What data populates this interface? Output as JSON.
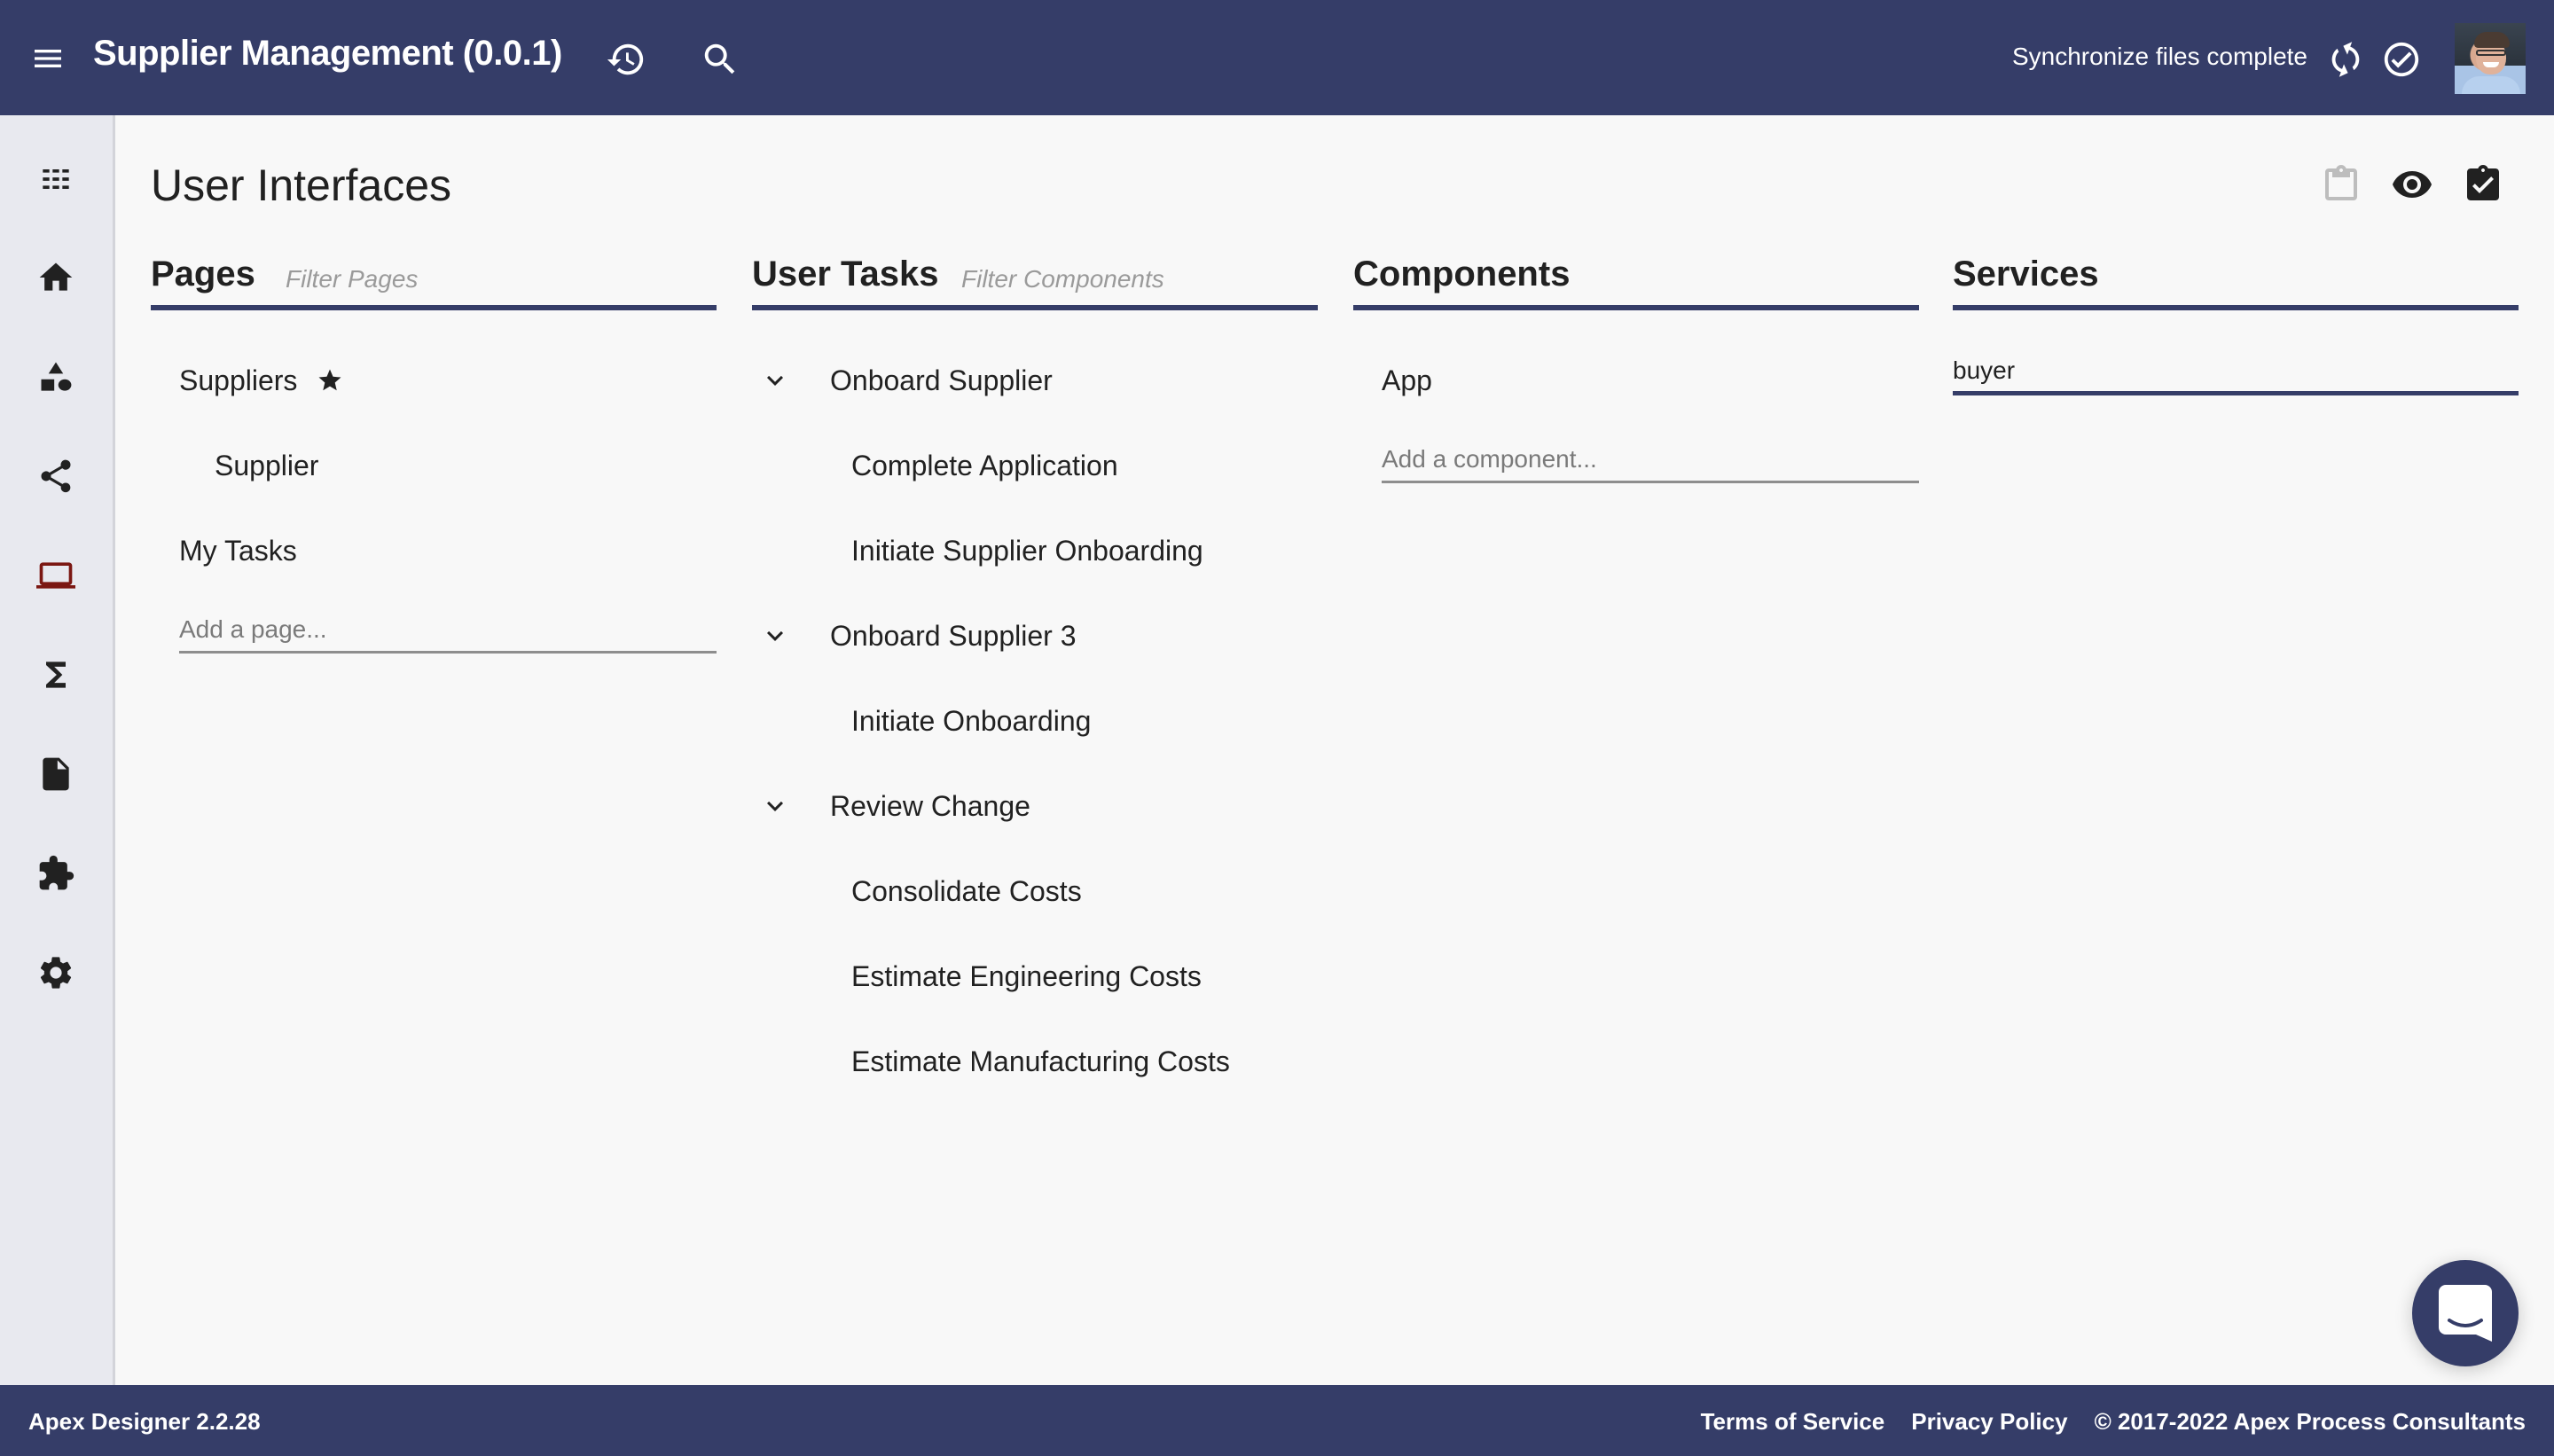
{
  "header": {
    "title": "Supplier Management (0.0.1)",
    "menu_icon": "menu-icon",
    "history_icon": "history-icon",
    "search_icon": "search-icon",
    "sync_status": "Synchronize files complete",
    "sync_icon": "sync-icon",
    "sync_complete_icon": "check-circle-icon",
    "avatar_alt": "User avatar"
  },
  "sidebar": {
    "items": [
      {
        "name": "apps",
        "icon": "apps-grid-icon",
        "active": false
      },
      {
        "name": "home",
        "icon": "home-icon",
        "active": false
      },
      {
        "name": "business-objects",
        "icon": "category-shapes-icon",
        "active": false
      },
      {
        "name": "processes",
        "icon": "share-icon",
        "active": false
      },
      {
        "name": "user-interfaces",
        "icon": "laptop-icon",
        "active": true
      },
      {
        "name": "functions",
        "icon": "sigma-icon",
        "active": false
      },
      {
        "name": "documents",
        "icon": "file-icon",
        "active": false
      },
      {
        "name": "libraries",
        "icon": "extension-puzzle-icon",
        "active": false
      },
      {
        "name": "settings",
        "icon": "gear-icon",
        "active": false
      }
    ],
    "active_color": "#7b1712"
  },
  "page": {
    "title": "User Interfaces",
    "actions": [
      {
        "name": "paste",
        "icon": "clipboard-icon",
        "disabled": true
      },
      {
        "name": "preview",
        "icon": "eye-icon",
        "disabled": false
      },
      {
        "name": "validate",
        "icon": "assignment-check-icon",
        "disabled": false
      }
    ]
  },
  "columns": {
    "pages": {
      "title": "Pages",
      "filter_placeholder": "Filter Pages",
      "items": [
        {
          "label": "Suppliers",
          "level": 0,
          "starred": true
        },
        {
          "label": "Supplier",
          "level": 1,
          "starred": false
        },
        {
          "label": "My Tasks",
          "level": 0,
          "starred": false
        }
      ],
      "add_placeholder": "Add a page..."
    },
    "user_tasks": {
      "title": "User Tasks",
      "filter_placeholder": "Filter Components",
      "groups": [
        {
          "label": "Onboard Supplier",
          "expanded": true,
          "tasks": [
            "Complete Application",
            "Initiate Supplier Onboarding"
          ]
        },
        {
          "label": "Onboard Supplier 3",
          "expanded": true,
          "tasks": [
            "Initiate Onboarding"
          ]
        },
        {
          "label": "Review Change",
          "expanded": true,
          "tasks": [
            "Consolidate Costs",
            "Estimate Engineering Costs",
            "Estimate Manufacturing Costs"
          ]
        }
      ]
    },
    "components": {
      "title": "Components",
      "items": [
        {
          "label": "App"
        }
      ],
      "add_placeholder": "Add a component..."
    },
    "services": {
      "title": "Services",
      "input_value": "buyer"
    }
  },
  "chat": {
    "icon": "chat-bubble-icon"
  },
  "footer": {
    "version": "Apex Designer 2.2.28",
    "terms": "Terms of Service",
    "privacy": "Privacy Policy",
    "copyright": "© 2017-2022 Apex Process Consultants"
  },
  "colors": {
    "brand": "#353d68",
    "background": "#f8f8f8",
    "sidebar": "#e8e9ef",
    "active_nav": "#7b1712"
  }
}
